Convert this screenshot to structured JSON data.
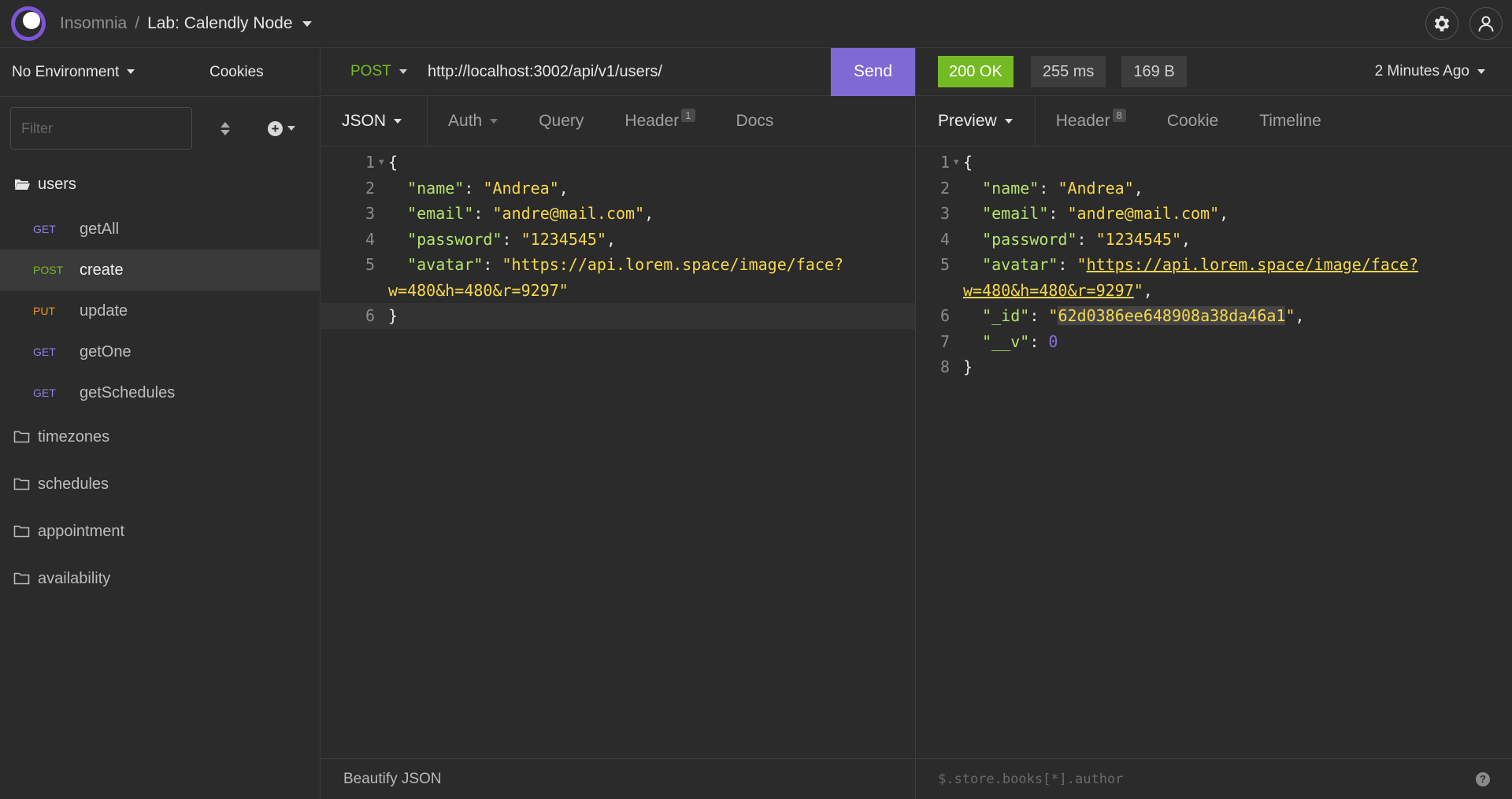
{
  "header": {
    "app_name": "Insomnia",
    "separator": "/",
    "workspace": "Lab: Calendly Node"
  },
  "sidebar": {
    "environment": "No Environment",
    "cookies": "Cookies",
    "filter_placeholder": "Filter",
    "folders": [
      {
        "name": "users",
        "open": true,
        "requests": [
          {
            "method": "GET",
            "name": "getAll"
          },
          {
            "method": "POST",
            "name": "create",
            "active": true
          },
          {
            "method": "PUT",
            "name": "update"
          },
          {
            "method": "GET",
            "name": "getOne"
          },
          {
            "method": "GET",
            "name": "getSchedules"
          }
        ]
      },
      {
        "name": "timezones"
      },
      {
        "name": "schedules"
      },
      {
        "name": "appointment"
      },
      {
        "name": "availability"
      }
    ]
  },
  "request": {
    "method": "POST",
    "url": "http://localhost:3002/api/v1/users/",
    "send_label": "Send",
    "tabs": {
      "body": "JSON",
      "auth": "Auth",
      "query": "Query",
      "header": "Header",
      "header_count": "1",
      "docs": "Docs"
    },
    "body_lines": [
      "1",
      "2",
      "3",
      "4",
      "5",
      "6"
    ],
    "body": {
      "name_key": "\"name\"",
      "name_val": "\"Andrea\"",
      "email_key": "\"email\"",
      "email_val": "\"andre@mail.com\"",
      "password_key": "\"password\"",
      "password_val": "\"1234545\"",
      "avatar_key": "\"avatar\"",
      "avatar_val_1": "\"https://api.lorem.space/image/face?",
      "avatar_val_2": "w=480&h=480&r=9297\""
    },
    "footer": "Beautify JSON"
  },
  "response": {
    "status": "200 OK",
    "time": "255 ms",
    "size": "169 B",
    "ago": "2 Minutes Ago",
    "tabs": {
      "preview": "Preview",
      "header": "Header",
      "header_count": "8",
      "cookie": "Cookie",
      "timeline": "Timeline"
    },
    "body": {
      "name_key": "\"name\"",
      "name_val": "\"Andrea\"",
      "email_key": "\"email\"",
      "email_val": "\"andre@mail.com\"",
      "password_key": "\"password\"",
      "password_val": "\"1234545\"",
      "avatar_key": "\"avatar\"",
      "avatar_url_1": "https://api.lorem.space/image/face?",
      "avatar_url_2": "w=480&h=480&r=9297",
      "id_key": "\"_id\"",
      "id_val": "62d0386ee648908a38da46a1",
      "v_key": "\"__v\"",
      "v_val": "0"
    },
    "filter_placeholder": "$.store.books[*].author"
  },
  "colors": {
    "accent": "#7e6ad3",
    "get": "#8f7ee6",
    "post": "#75ba24",
    "put": "#e8912a",
    "status_ok": "#75ba24"
  }
}
